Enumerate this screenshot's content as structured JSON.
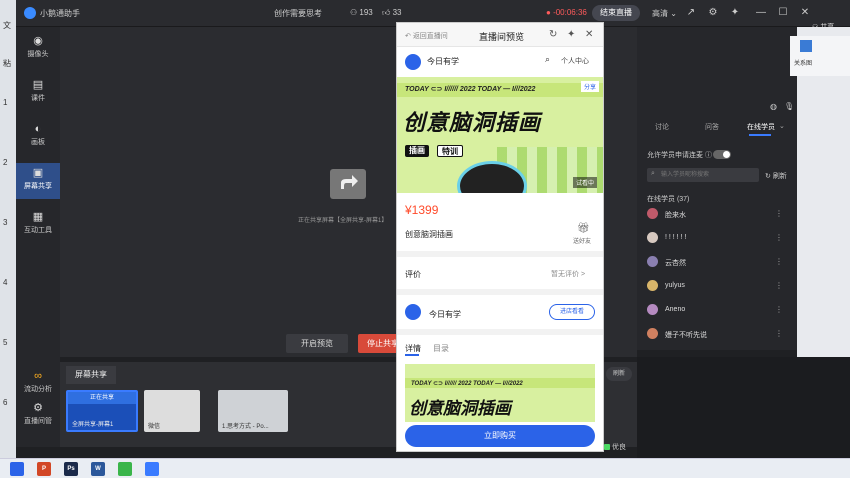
{
  "titlebar": {
    "app_title": "小鹅通助手",
    "course_title": "创作需要思考",
    "people_count": "193",
    "like_count": "33",
    "timer": "-00:06:36",
    "end_live_label": "结束直播",
    "quality_label": "高清",
    "share_label": "共享"
  },
  "ppt_numbers": [
    "1",
    "2",
    "3",
    "4",
    "5",
    "6"
  ],
  "ppt_left_letters": [
    "文",
    "粘"
  ],
  "tools": [
    {
      "label": "摄像头",
      "icon": "camera-icon"
    },
    {
      "label": "课件",
      "icon": "file-icon"
    },
    {
      "label": "画板",
      "icon": "palette-icon"
    },
    {
      "label": "屏幕共享",
      "icon": "screen-share-icon"
    },
    {
      "label": "互动工具",
      "icon": "tools-icon"
    }
  ],
  "bottom_tools": [
    {
      "label": "流动分析",
      "icon": "flow-icon"
    },
    {
      "label": "直播间管",
      "icon": "settings-icon"
    }
  ],
  "stage": {
    "share_hint": "正在共享屏幕【全屏共享-屏幕1】",
    "start_preview": "开启预览",
    "stop_share": "停止共享"
  },
  "share_panel": {
    "tab_label": "屏幕共享",
    "refresh_label": "刷新",
    "thumbs": [
      {
        "status": "正在共享",
        "label": "全屏共享-屏幕1"
      },
      {
        "status": "",
        "label": "微信"
      },
      {
        "status": "",
        "label": "1.思考方式 - Po..."
      }
    ]
  },
  "network": {
    "label": "优良"
  },
  "right_panel": {
    "tabs": [
      "讨论",
      "问答",
      "在线学员"
    ],
    "allow_connect": "允许学员申请连麦",
    "search_placeholder": "输入学员昵称搜索",
    "refresh_label": "刷新",
    "online_header": "在线学员 (37)",
    "students": [
      {
        "name": "脸来水",
        "color": "#c05a6a"
      },
      {
        "name": "! ! ! ! ! !",
        "color": "#d7c9c0"
      },
      {
        "name": "云杏然",
        "color": "#8a7fb0"
      },
      {
        "name": "yulyus",
        "color": "#d8b56a"
      },
      {
        "name": "Aneno",
        "color": "#b58ac0"
      },
      {
        "name": "嫚子不听先说",
        "color": "#d08060"
      }
    ],
    "ppt_right_label": "关系图"
  },
  "phone": {
    "back_label": "返回直播间",
    "title": "直播间预览",
    "brand_name": "今日有学",
    "user_center": "个人中心",
    "share_tag": "分享",
    "banner_today": "TODAY ⊂⊃ I////// 2022 TODAY — I///2022",
    "banner_title": "创意脑洞插画",
    "tag_1": "插画",
    "tag_2": "特训",
    "banner_badge": "试看中",
    "price": "¥1399",
    "product_name": "创意脑洞插画",
    "gift_label": "送好友",
    "review_label": "评价",
    "review_none": "暂无评价 >",
    "shop_name": "今日有学",
    "enter_shop": "进店看看",
    "tab_detail": "详情",
    "tab_catalog": "目录",
    "banner2_today": "TODAY ⊂⊃ I////// 2022 TODAY — I///2022",
    "banner2_title": "创意脑洞插画",
    "buy_label": "立即购买"
  },
  "taskbar": {
    "items": [
      {
        "icon": "windows-start-icon",
        "text": "",
        "color": "#2b63e8"
      },
      {
        "icon": "powerpoint-icon",
        "text": "P",
        "color": "#d24726"
      },
      {
        "icon": "photoshop-icon",
        "text": "Ps",
        "color": "#1b2a4a"
      },
      {
        "icon": "word-icon",
        "text": "W",
        "color": "#2b579a"
      },
      {
        "icon": "wechat-icon",
        "text": "",
        "color": "#3ab54a"
      },
      {
        "icon": "xiaoetong-icon",
        "text": "",
        "color": "#3a7bff"
      }
    ]
  }
}
